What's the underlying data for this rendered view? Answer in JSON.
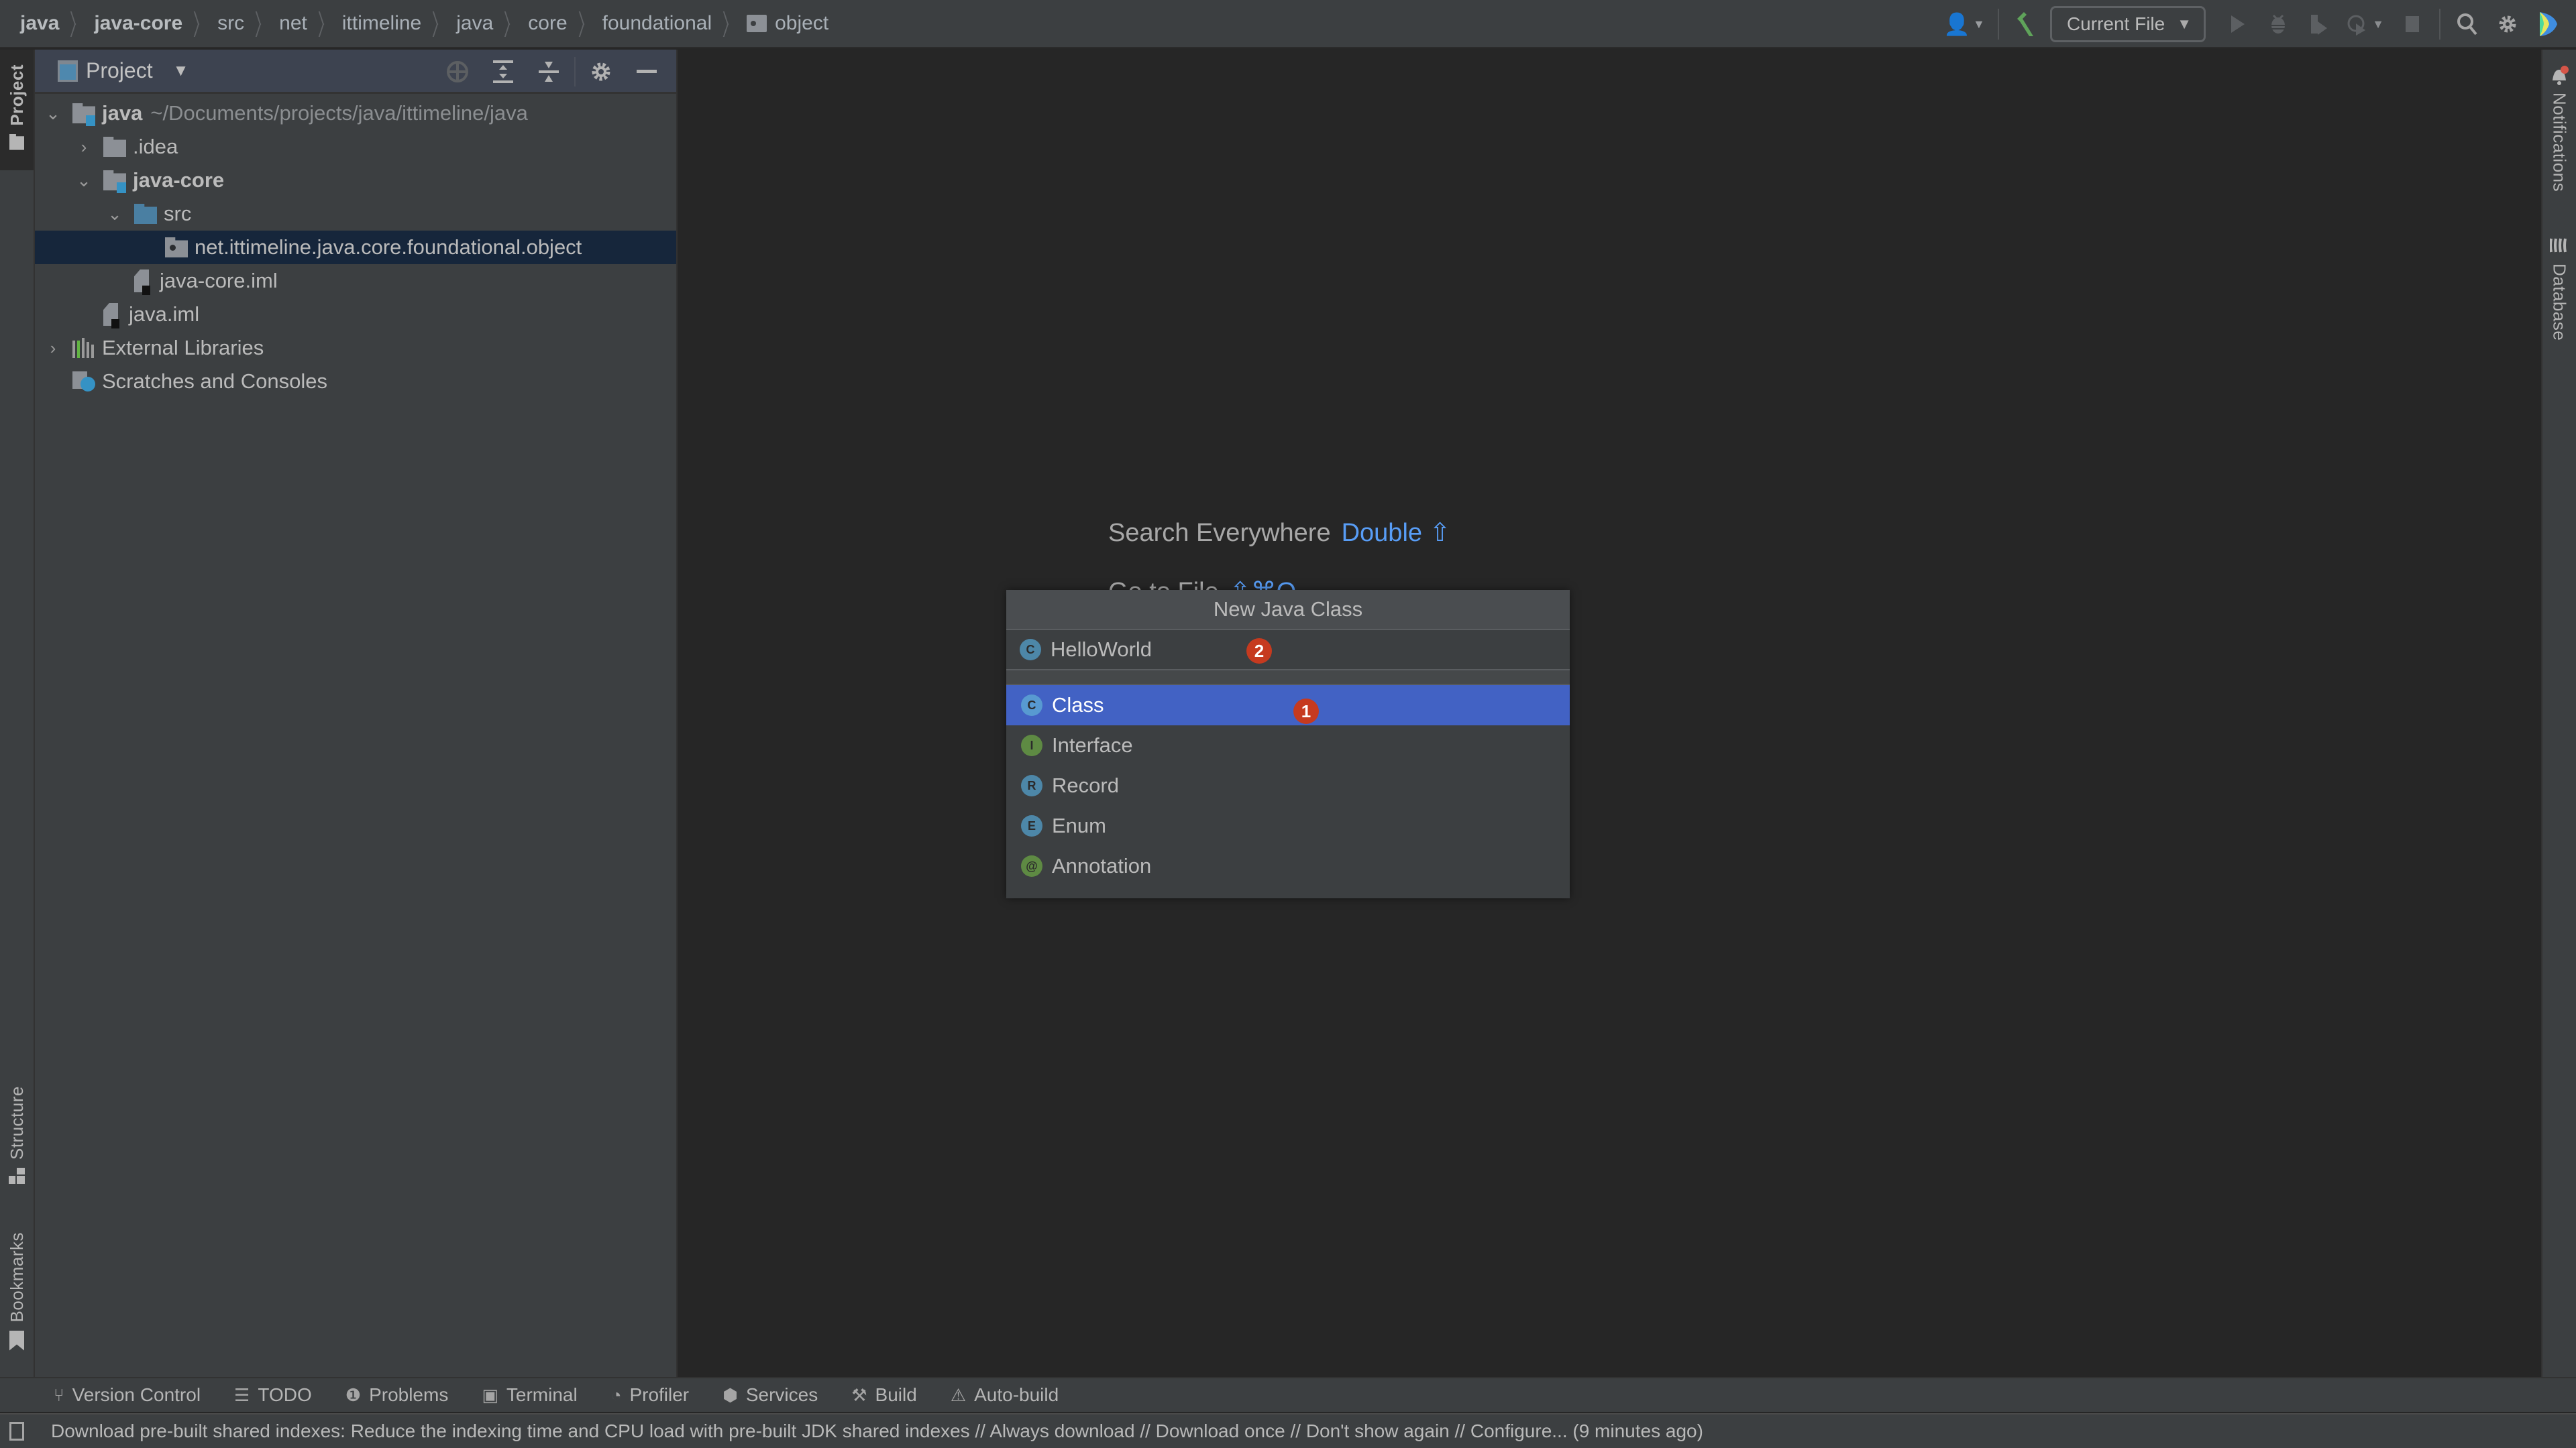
{
  "breadcrumbs": [
    {
      "label": "java",
      "bold": true
    },
    {
      "label": "java-core",
      "bold": true
    },
    {
      "label": "src"
    },
    {
      "label": "net"
    },
    {
      "label": "ittimeline"
    },
    {
      "label": "java"
    },
    {
      "label": "core"
    },
    {
      "label": "foundational"
    },
    {
      "label": "object",
      "icon": "package-folder-icon"
    }
  ],
  "toolbar": {
    "run_config": "Current File",
    "icons": [
      "user-icon",
      "build-hammer-icon",
      "run-icon",
      "debug-icon",
      "coverage-icon",
      "profile-icon",
      "stop-icon",
      "search-icon",
      "settings-icon",
      "jetbrains-logo-icon"
    ]
  },
  "left_strip": {
    "top_tabs": [
      {
        "label": "Project",
        "active": true
      }
    ],
    "bottom_tabs": [
      {
        "label": "Structure"
      },
      {
        "label": "Bookmarks"
      }
    ]
  },
  "right_strip": {
    "tabs": [
      {
        "label": "Notifications",
        "has_alert": true
      },
      {
        "label": "Database"
      }
    ]
  },
  "project_pane": {
    "title": "Project",
    "tree": [
      {
        "label": "java",
        "bold": true,
        "path": "~/Documents/projects/java/ittimeline/java",
        "expanded": true,
        "depth": 0,
        "icon": "module"
      },
      {
        "label": ".idea",
        "expanded": false,
        "depth": 1,
        "icon": "folder"
      },
      {
        "label": "java-core",
        "bold": true,
        "expanded": true,
        "depth": 1,
        "icon": "module"
      },
      {
        "label": "src",
        "expanded": true,
        "depth": 2,
        "icon": "source-folder"
      },
      {
        "label": "net.ittimeline.java.core.foundational.object",
        "depth": 3,
        "icon": "package",
        "selected": true
      },
      {
        "label": "java-core.iml",
        "depth": 2,
        "icon": "iml-file"
      },
      {
        "label": "java.iml",
        "depth": 1,
        "icon": "iml-file"
      },
      {
        "label": "External Libraries",
        "expanded": false,
        "depth": 0,
        "icon": "libraries"
      },
      {
        "label": "Scratches and Consoles",
        "depth": 0,
        "icon": "scratches"
      }
    ]
  },
  "editor_hints": {
    "search_label": "Search Everywhere",
    "search_key": "Double ⇧",
    "goto_label": "Go to File",
    "goto_key": "⇧⌘O"
  },
  "new_class_popup": {
    "title": "New Java Class",
    "input_value": "HelloWorld",
    "input_badge": "2",
    "items": [
      {
        "label": "Class",
        "icon_letter": "C",
        "selected": true,
        "badge": "1"
      },
      {
        "label": "Interface",
        "icon_letter": "I"
      },
      {
        "label": "Record",
        "icon_letter": "R"
      },
      {
        "label": "Enum",
        "icon_letter": "E"
      },
      {
        "label": "Annotation",
        "icon_letter": "@"
      }
    ]
  },
  "bottom_bar": [
    {
      "label": "Version Control",
      "icon": "⑂"
    },
    {
      "label": "TODO",
      "icon": "☰"
    },
    {
      "label": "Problems",
      "icon": "❶"
    },
    {
      "label": "Terminal",
      "icon": "▣"
    },
    {
      "label": "Profiler",
      "icon": "◔"
    },
    {
      "label": "Services",
      "icon": "⬢"
    },
    {
      "label": "Build",
      "icon": "⚒"
    },
    {
      "label": "Auto-build",
      "icon": "⚠"
    }
  ],
  "status_message": "Download pre-built shared indexes: Reduce the indexing time and CPU load with pre-built JDK shared indexes // Always download // Download once // Don't show again // Configure... (9 minutes ago)"
}
